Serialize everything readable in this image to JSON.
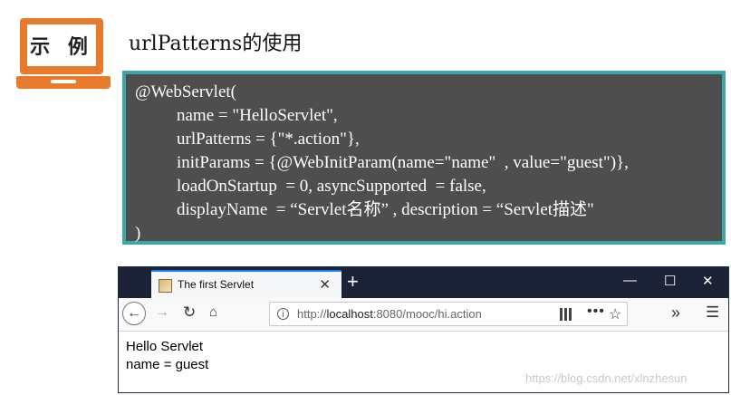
{
  "badge": {
    "label": "示 例"
  },
  "title": "urlPatterns的使用",
  "code": {
    "lines": [
      "@WebServlet(",
      "name = \"HelloServlet\",",
      "urlPatterns = {\"*.action\"},",
      "initParams = {@WebInitParam(name=\"name\"  , value=\"guest\")},",
      "loadOnStartup  = 0, asyncSupported  = false,",
      "displayName  = “Servlet名称” , description = “Servlet描述\"",
      ")"
    ]
  },
  "browser": {
    "tab_title": "The first Servlet",
    "url_prefix": "http://",
    "url_host": "localhost",
    "url_rest": ":8080/mooc/hi.action",
    "icons": {
      "back": "back-arrow-icon",
      "forward": "forward-arrow-icon",
      "reload": "reload-icon",
      "home": "home-icon",
      "info": "info-icon",
      "qr": "qr-code-icon",
      "more": "more-dots-icon",
      "star": "bookmark-star-icon",
      "overflow": "overflow-chevron-icon",
      "menu": "hamburger-menu-icon"
    },
    "page_lines": [
      "Hello Servlet",
      "name = guest"
    ]
  },
  "watermark": "https://blog.csdn.net/xlnzhesun",
  "colors": {
    "accent_orange": "#e87a2b",
    "code_bg": "#4e4e4e",
    "code_border": "#3aa6a8",
    "titlebar": "#1c2236"
  }
}
